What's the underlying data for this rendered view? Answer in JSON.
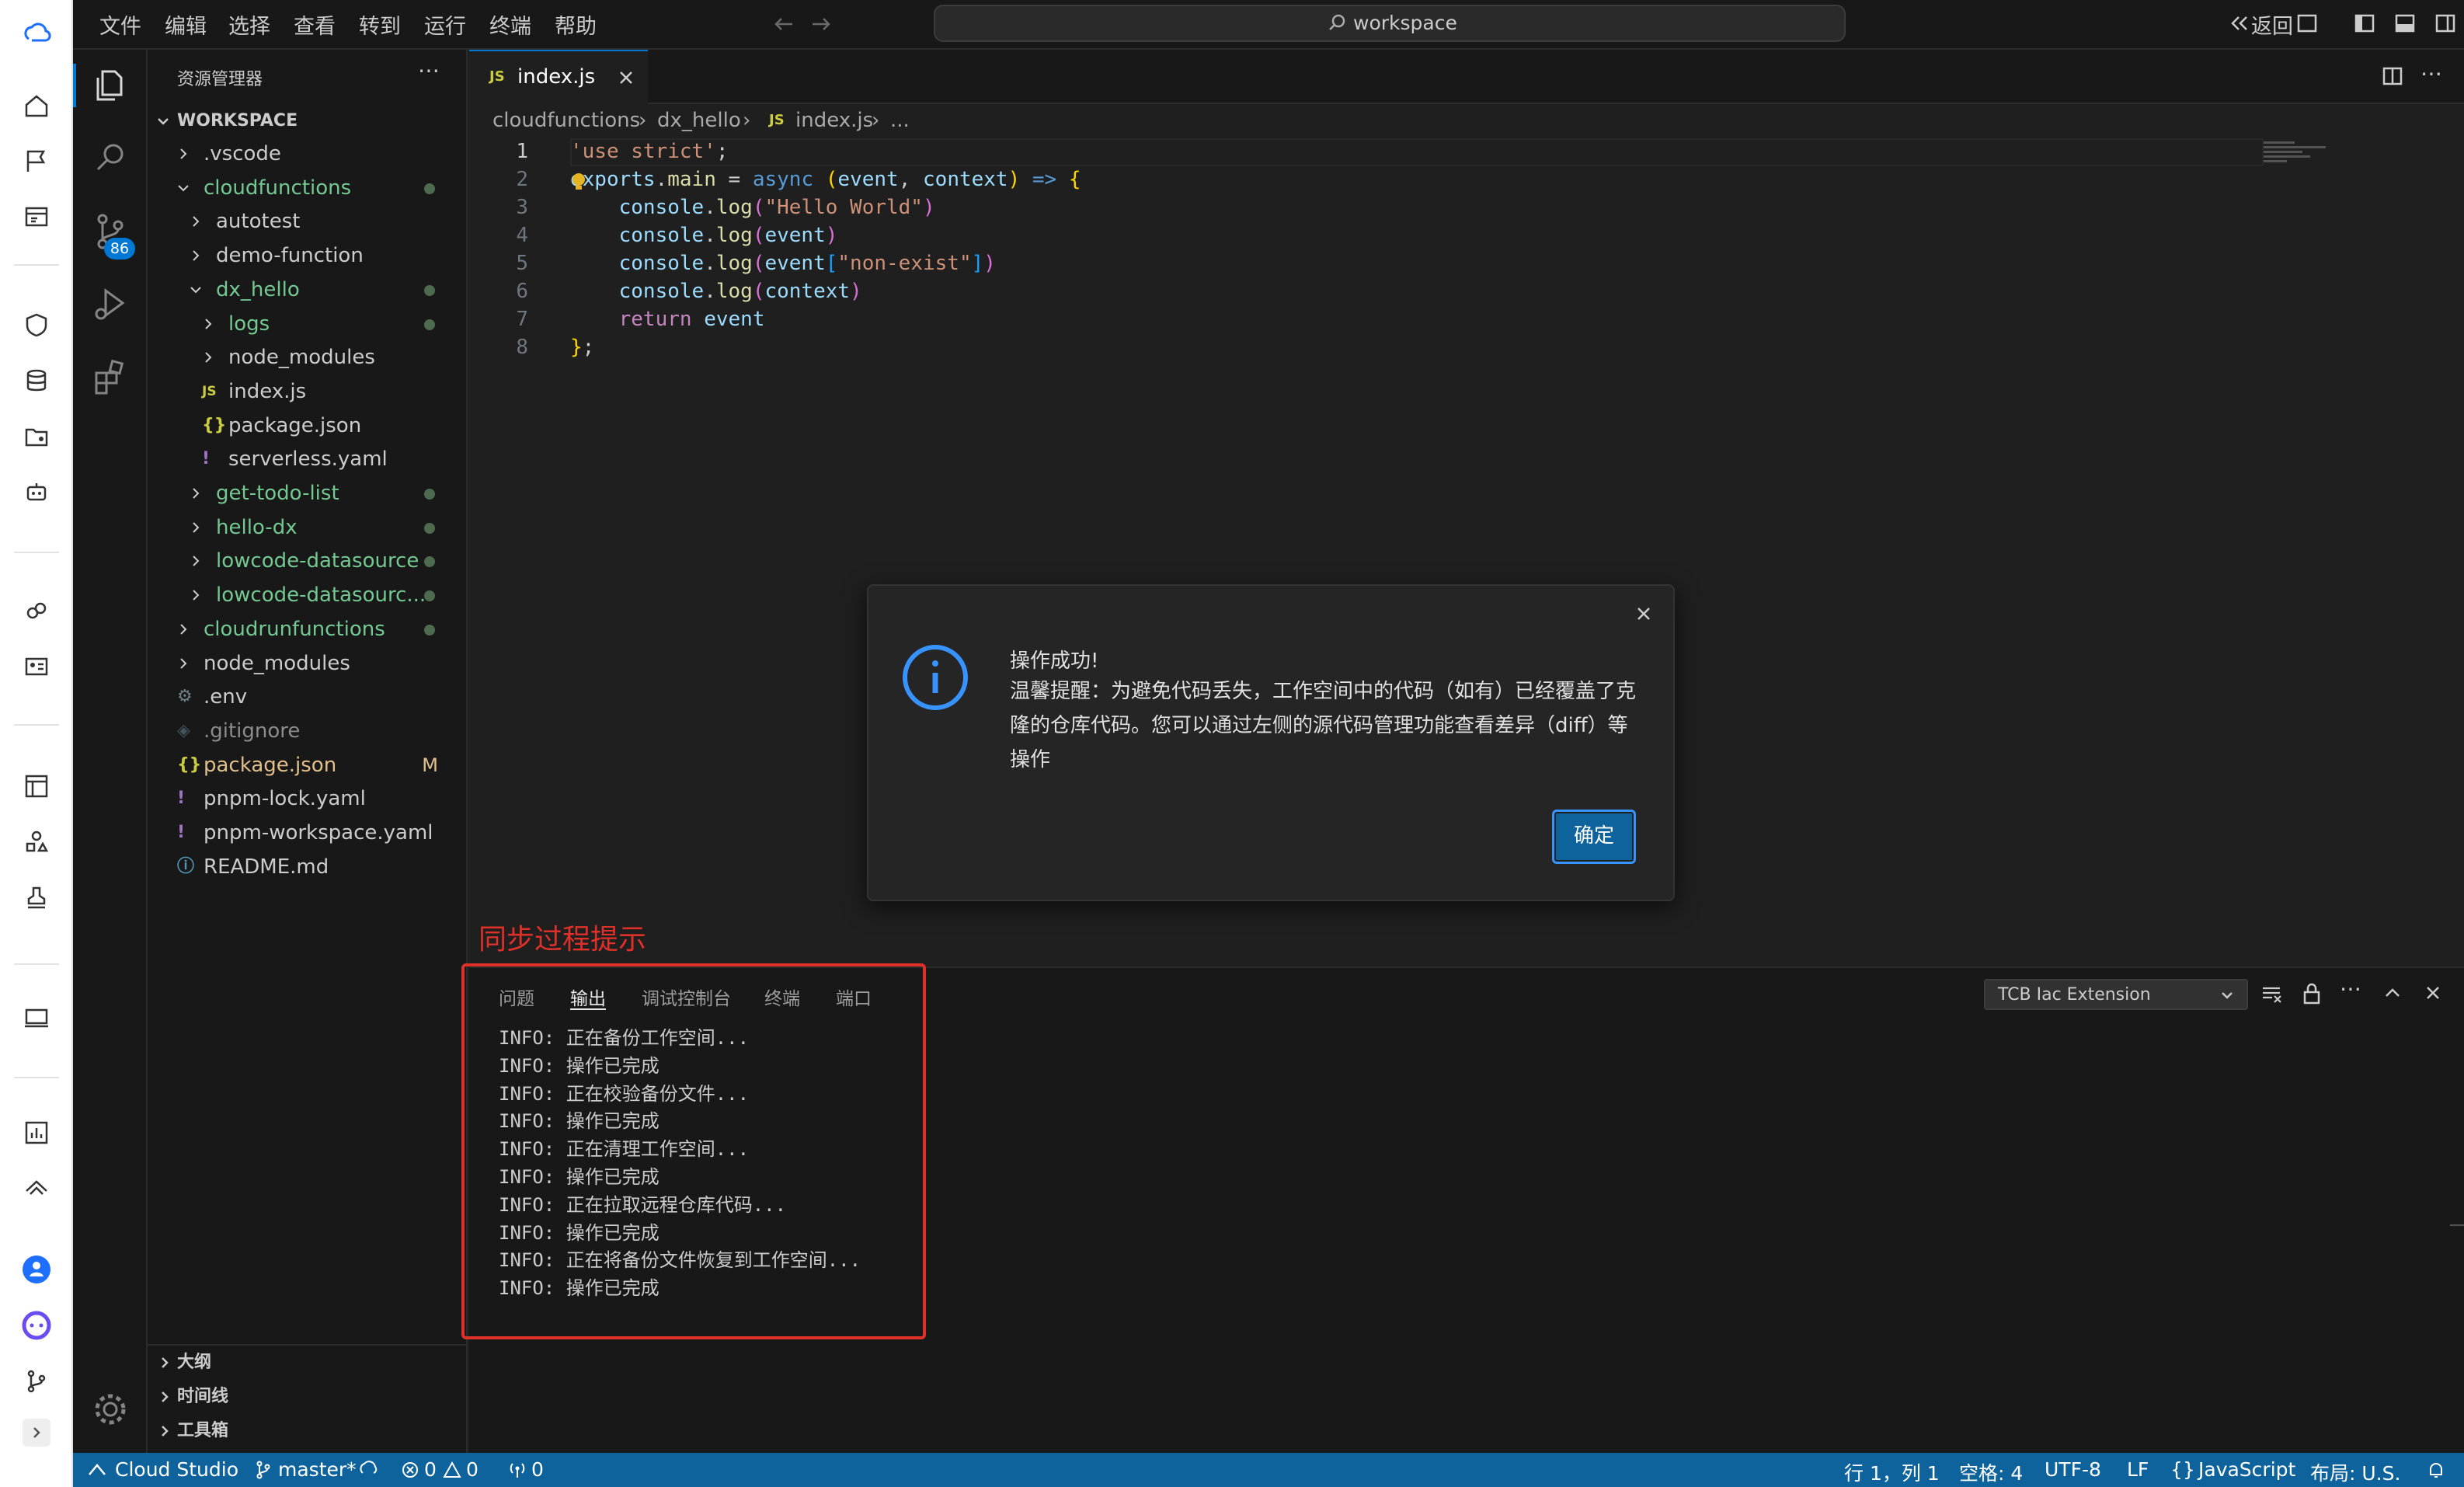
{
  "menu": [
    "文件",
    "编辑",
    "选择",
    "查看",
    "转到",
    "运行",
    "终端",
    "帮助"
  ],
  "title_search": "workspace",
  "back_label": "返回",
  "activity": {
    "scm_badge": "86"
  },
  "explorer": {
    "title": "资源管理器",
    "root": "WORKSPACE",
    "items": [
      {
        "label": ".vscode",
        "color": "#cccccc"
      },
      {
        "label": "cloudfunctions",
        "color": "#73c991"
      },
      {
        "label": "autotest",
        "color": "#cccccc"
      },
      {
        "label": "demo-function",
        "color": "#cccccc"
      },
      {
        "label": "dx_hello",
        "color": "#73c991"
      },
      {
        "label": "logs",
        "color": "#73c991"
      },
      {
        "label": "node_modules",
        "color": "#cccccc"
      },
      {
        "label": "index.js",
        "color": "#cccccc"
      },
      {
        "label": "package.json",
        "color": "#cccccc"
      },
      {
        "label": "serverless.yaml",
        "color": "#cccccc"
      },
      {
        "label": "get-todo-list",
        "color": "#73c991"
      },
      {
        "label": "hello-dx",
        "color": "#73c991"
      },
      {
        "label": "lowcode-datasource",
        "color": "#73c991"
      },
      {
        "label": "lowcode-datasourc...",
        "color": "#73c991"
      },
      {
        "label": "cloudrunfunctions",
        "color": "#73c991"
      },
      {
        "label": "node_modules",
        "color": "#cccccc"
      },
      {
        "label": ".env",
        "color": "#cccccc"
      },
      {
        "label": ".gitignore",
        "color": "#8c8c8c"
      },
      {
        "label": "package.json",
        "color": "#e2c08d"
      },
      {
        "label": "pnpm-lock.yaml",
        "color": "#cccccc"
      },
      {
        "label": "pnpm-workspace.yaml",
        "color": "#cccccc"
      },
      {
        "label": "README.md",
        "color": "#cccccc"
      }
    ],
    "modified_mark": "M",
    "sections": [
      "大纲",
      "时间线",
      "工具箱"
    ]
  },
  "editor": {
    "tab_label": "index.js",
    "tab_file_badge": "JS",
    "breadcrumb": [
      "cloudfunctions",
      "dx_hello",
      "index.js",
      "..."
    ],
    "code_lines": [
      [
        {
          "t": "'use strict'",
          "c": "#ce9178"
        },
        {
          "t": ";",
          "c": "#cccccc"
        }
      ],
      [
        {
          "t": "exports",
          "c": "#9cdcfe"
        },
        {
          "t": ".",
          "c": "#cccccc"
        },
        {
          "t": "main",
          "c": "#dcdcaa"
        },
        {
          "t": " = ",
          "c": "#cccccc"
        },
        {
          "t": "async",
          "c": "#569cd6"
        },
        {
          "t": " (",
          "c": "#ffd700"
        },
        {
          "t": "event",
          "c": "#9cdcfe"
        },
        {
          "t": ", ",
          "c": "#cccccc"
        },
        {
          "t": "context",
          "c": "#9cdcfe"
        },
        {
          "t": ")",
          "c": "#ffd700"
        },
        {
          "t": " => ",
          "c": "#569cd6"
        },
        {
          "t": "{",
          "c": "#ffd700"
        }
      ],
      [
        {
          "t": "    console",
          "c": "#9cdcfe"
        },
        {
          "t": ".",
          "c": "#cccccc"
        },
        {
          "t": "log",
          "c": "#dcdcaa"
        },
        {
          "t": "(",
          "c": "#da70d6"
        },
        {
          "t": "\"Hello World\"",
          "c": "#ce9178"
        },
        {
          "t": ")",
          "c": "#da70d6"
        }
      ],
      [
        {
          "t": "    console",
          "c": "#9cdcfe"
        },
        {
          "t": ".",
          "c": "#cccccc"
        },
        {
          "t": "log",
          "c": "#dcdcaa"
        },
        {
          "t": "(",
          "c": "#da70d6"
        },
        {
          "t": "event",
          "c": "#9cdcfe"
        },
        {
          "t": ")",
          "c": "#da70d6"
        }
      ],
      [
        {
          "t": "    console",
          "c": "#9cdcfe"
        },
        {
          "t": ".",
          "c": "#cccccc"
        },
        {
          "t": "log",
          "c": "#dcdcaa"
        },
        {
          "t": "(",
          "c": "#da70d6"
        },
        {
          "t": "event",
          "c": "#9cdcfe"
        },
        {
          "t": "[",
          "c": "#179fff"
        },
        {
          "t": "\"non-exist\"",
          "c": "#ce9178"
        },
        {
          "t": "]",
          "c": "#179fff"
        },
        {
          "t": ")",
          "c": "#da70d6"
        }
      ],
      [
        {
          "t": "    console",
          "c": "#9cdcfe"
        },
        {
          "t": ".",
          "c": "#cccccc"
        },
        {
          "t": "log",
          "c": "#dcdcaa"
        },
        {
          "t": "(",
          "c": "#da70d6"
        },
        {
          "t": "context",
          "c": "#9cdcfe"
        },
        {
          "t": ")",
          "c": "#da70d6"
        }
      ],
      [
        {
          "t": "    return",
          "c": "#c586c0"
        },
        {
          "t": " event",
          "c": "#9cdcfe"
        }
      ],
      [
        {
          "t": "}",
          "c": "#ffd700"
        },
        {
          "t": ";",
          "c": "#cccccc"
        }
      ]
    ]
  },
  "annotation": "同步过程提示",
  "panel": {
    "tabs": [
      "问题",
      "输出",
      "调试控制台",
      "终端",
      "端口"
    ],
    "active_tab": 1,
    "output_channel": "TCB Iac Extension",
    "output_lines": [
      "INFO: 正在备份工作空间...",
      "INFO: 操作已完成",
      "INFO: 正在校验备份文件...",
      "INFO: 操作已完成",
      "INFO: 正在清理工作空间...",
      "INFO: 操作已完成",
      "INFO: 正在拉取远程仓库代码...",
      "INFO: 操作已完成",
      "INFO: 正在将备份文件恢复到工作空间...",
      "INFO: 操作已完成"
    ]
  },
  "dialog": {
    "title": "操作成功!",
    "message": "温馨提醒：为避免代码丢失，工作空间中的代码（如有）已经覆盖了克隆的仓库代码。您可以通过左侧的源代码管理功能查看差异（diff）等操作",
    "ok_label": "确定"
  },
  "status": {
    "brand": "Cloud Studio",
    "branch": "master*",
    "errors": "0",
    "warnings": "0",
    "ports": "0",
    "position": "行 1，列 1",
    "spaces": "空格: 4",
    "encoding": "UTF-8",
    "eol": "LF",
    "language": "JavaScript",
    "layout": "布局: U.S."
  },
  "colors": {
    "accent": "#0078d4",
    "statusbar": "#0e639c",
    "annotation_red": "#e0302a",
    "git_added": "#73c991"
  }
}
